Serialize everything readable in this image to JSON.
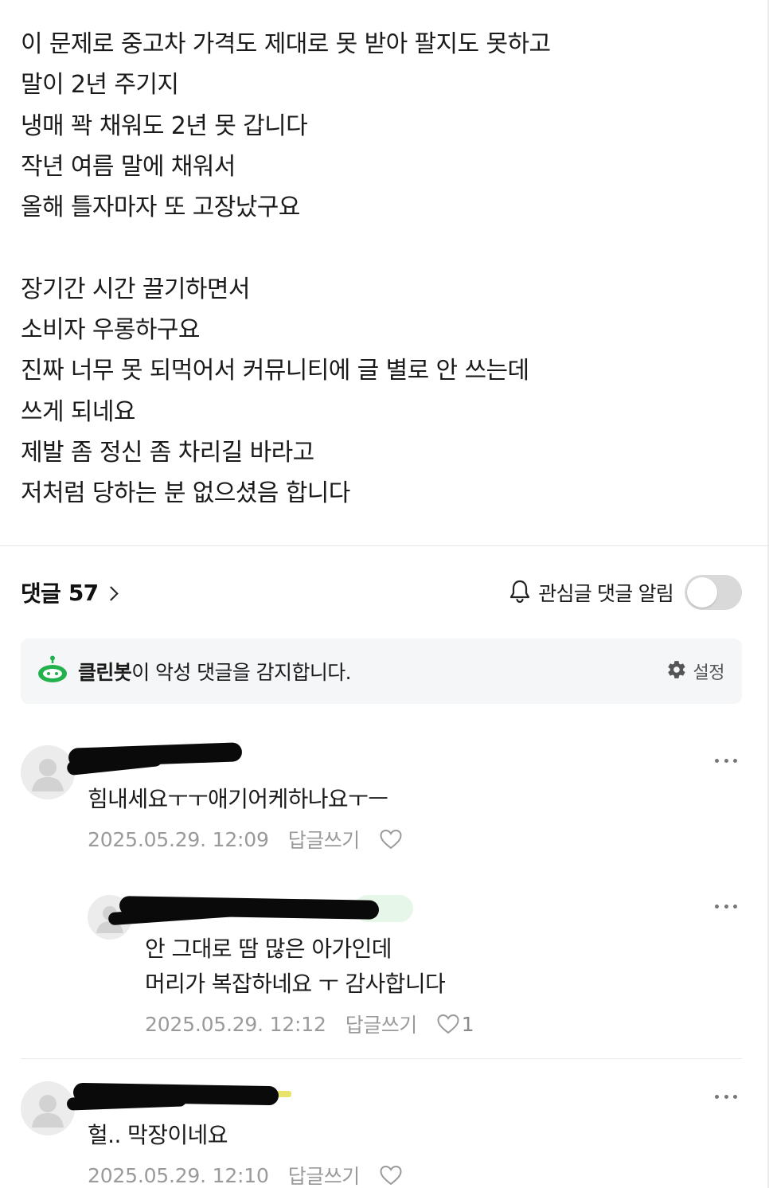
{
  "article": {
    "lines": [
      "이 문제로 중고차 가격도 제대로 못 받아 팔지도 못하고",
      "말이 2년 주기지",
      "냉매 꽉 채워도 2년 못 갑니다",
      "작년 여름 말에 채워서",
      "올해 틀자마자 또 고장났구요",
      "",
      "장기간 시간 끌기하면서",
      "소비자 우롱하구요",
      "진짜 너무 못 되먹어서 커뮤니티에 글 별로 안 쓰는데",
      "쓰게 되네요",
      "제발 좀 정신 좀 차리길 바라고",
      "저처럼 당하는 분 없으셨음 합니다"
    ]
  },
  "comments_header": {
    "title": "댓글",
    "count": "57",
    "notify_label": "관심글 댓글 알림",
    "notify_enabled": false
  },
  "cleanbot": {
    "name": "클린봇",
    "message": "이 악성 댓글을 감지합니다.",
    "settings_label": "설정",
    "brand_color": "#22b14c"
  },
  "comments": [
    {
      "text_lines": [
        "힘내세요ㅜㅜ애기어케하나요ㅜㅡ"
      ],
      "date": "2025.05.29. 12:09",
      "reply_label": "답글쓰기",
      "likes": ""
    },
    {
      "text_lines": [
        "안 그대로 땀 많은 아가인데",
        "머리가 복잡하네요 ㅜ 감사합니다"
      ],
      "date": "2025.05.29. 12:12",
      "reply_label": "답글쓰기",
      "likes": "1"
    },
    {
      "text_lines": [
        "헐.. 막장이네요"
      ],
      "date": "2025.05.29. 12:10",
      "reply_label": "답글쓰기",
      "likes": ""
    }
  ]
}
